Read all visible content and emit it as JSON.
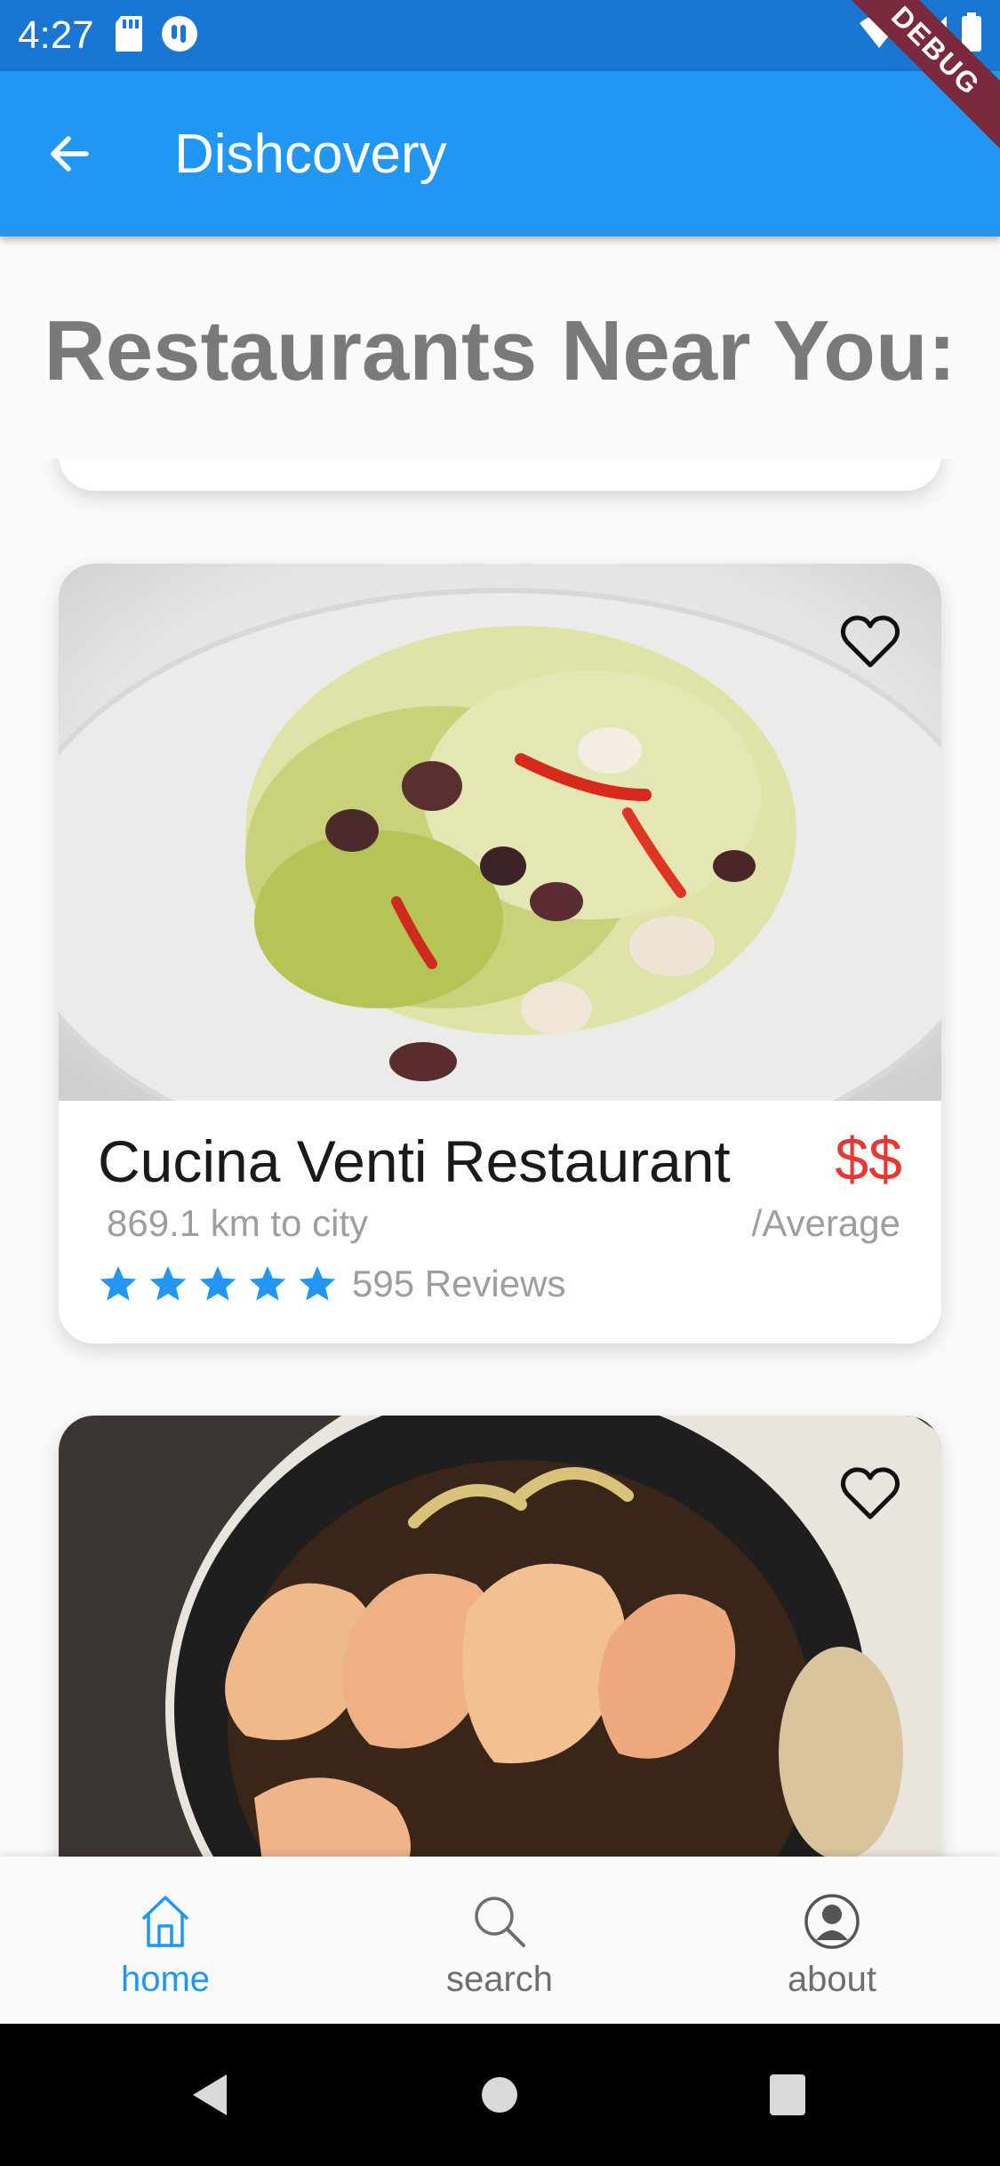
{
  "status_bar": {
    "time": "4:27",
    "left_icons": [
      "sd-card-icon",
      "app-notification-icon"
    ],
    "right_icons": [
      "wifi-icon",
      "signal-icon",
      "battery-icon"
    ],
    "debug_label": "DEBUG"
  },
  "app_bar": {
    "title": "Dishcovery",
    "back_icon": "arrow-back-icon"
  },
  "section": {
    "title": "Restaurants Near You:"
  },
  "restaurants": [
    {
      "name": "Cucina Venti Restaurant",
      "distance": "869.1 km to city",
      "price_symbol": "$$",
      "price_label": "/Average",
      "rating": 5,
      "reviews": "595 Reviews",
      "image": "salad-with-octopus-photo",
      "favorite_icon": "heart-outline-icon"
    },
    {
      "image": "garlic-shrimp-photo",
      "favorite_icon": "heart-outline-icon"
    }
  ],
  "bottom_nav": {
    "items": [
      {
        "label": "home",
        "icon": "home-icon",
        "active": true
      },
      {
        "label": "search",
        "icon": "search-icon",
        "active": false
      },
      {
        "label": "about",
        "icon": "person-icon",
        "active": false
      }
    ]
  },
  "system_nav": {
    "buttons": [
      "back-triangle-icon",
      "home-circle-icon",
      "recents-square-icon"
    ]
  },
  "colors": {
    "status_bar": "#1976d2",
    "app_bar": "#2196f3",
    "accent": "#2196f3",
    "price": "#e53935",
    "section_title": "#7a7a7a"
  }
}
